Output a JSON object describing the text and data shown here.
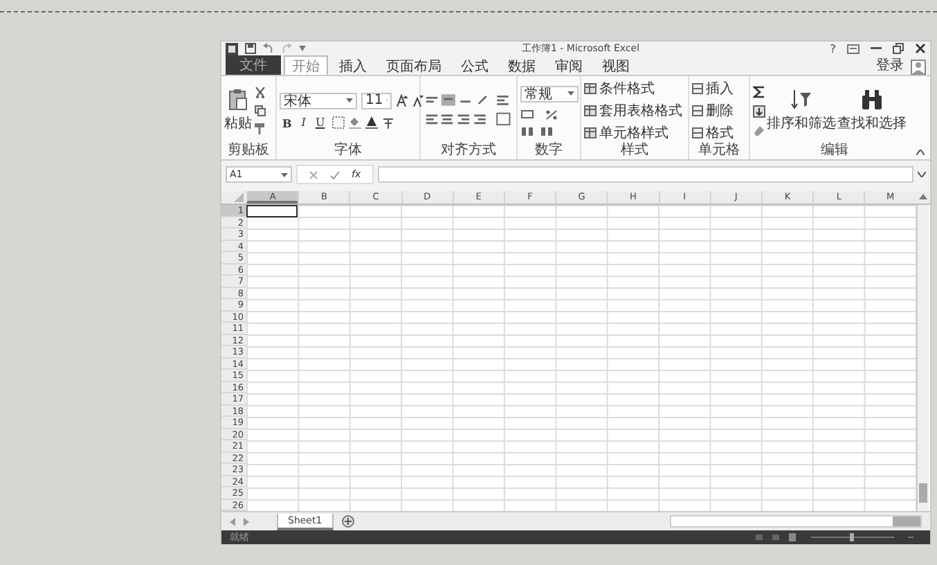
{
  "window": {
    "title": "工作簿1 - Microsoft Excel",
    "help": "?"
  },
  "ribbon_tabs": [
    {
      "label": "文件",
      "kind": "file",
      "selected": false
    },
    {
      "label": "开始",
      "kind": "tab",
      "selected": true
    },
    {
      "label": "插入",
      "kind": "tab",
      "selected": false
    },
    {
      "label": "页面布局",
      "kind": "tab",
      "selected": false
    },
    {
      "label": "公式",
      "kind": "tab",
      "selected": false
    },
    {
      "label": "数据",
      "kind": "tab",
      "selected": false
    },
    {
      "label": "审阅",
      "kind": "tab",
      "selected": false
    },
    {
      "label": "视图",
      "kind": "tab",
      "selected": false
    }
  ],
  "account": "登录",
  "clipboard": {
    "label": "剪贴板",
    "paste": "粘贴"
  },
  "font": {
    "label": "字体",
    "font_name": "宋体",
    "font_size": "11",
    "styles": [
      "B",
      "I",
      "U"
    ]
  },
  "alignment": {
    "label": "对齐方式"
  },
  "number": {
    "label": "数字",
    "format": "常规"
  },
  "styles": {
    "label": "样式",
    "items": [
      "条件格式",
      "套用表格格式",
      "单元格样式"
    ]
  },
  "cells": {
    "label": "单元格",
    "items": [
      "插入",
      "删除",
      "格式"
    ]
  },
  "editing": {
    "label": "编辑",
    "items": [
      "排序和筛选",
      "查找和选择"
    ]
  },
  "formula_bar": {
    "name_box": "A1",
    "function_label": "fx"
  },
  "columns": [
    {
      "label": "A",
      "selected": true
    },
    {
      "label": "B",
      "selected": false
    },
    {
      "label": "C",
      "selected": false
    },
    {
      "label": "D",
      "selected": false
    },
    {
      "label": "E",
      "selected": false
    },
    {
      "label": "F",
      "selected": false
    },
    {
      "label": "G",
      "selected": false
    },
    {
      "label": "H",
      "selected": false
    },
    {
      "label": "I",
      "selected": false
    },
    {
      "label": "J",
      "selected": false
    },
    {
      "label": "K",
      "selected": false
    },
    {
      "label": "L",
      "selected": false
    },
    {
      "label": "M",
      "selected": false
    }
  ],
  "rows": [
    {
      "label": "1",
      "selected": true
    },
    {
      "label": "2",
      "selected": false
    },
    {
      "label": "3",
      "selected": false
    },
    {
      "label": "4",
      "selected": false
    },
    {
      "label": "5",
      "selected": false
    },
    {
      "label": "6",
      "selected": false
    },
    {
      "label": "7",
      "selected": false
    },
    {
      "label": "8",
      "selected": false
    },
    {
      "label": "9",
      "selected": false
    },
    {
      "label": "10",
      "selected": false
    },
    {
      "label": "11",
      "selected": false
    },
    {
      "label": "12",
      "selected": false
    },
    {
      "label": "13",
      "selected": false
    },
    {
      "label": "14",
      "selected": false
    },
    {
      "label": "15",
      "selected": false
    },
    {
      "label": "16",
      "selected": false
    },
    {
      "label": "17",
      "selected": false
    },
    {
      "label": "18",
      "selected": false
    },
    {
      "label": "19",
      "selected": false
    },
    {
      "label": "20",
      "selected": false
    },
    {
      "label": "21",
      "selected": false
    },
    {
      "label": "22",
      "selected": false
    },
    {
      "label": "23",
      "selected": false
    },
    {
      "label": "24",
      "selected": false
    },
    {
      "label": "25",
      "selected": false
    },
    {
      "label": "26",
      "selected": false
    }
  ],
  "sheet_tabs": [
    {
      "label": "Sheet1",
      "selected": true
    }
  ],
  "status_bar": {
    "text": "就绪"
  }
}
